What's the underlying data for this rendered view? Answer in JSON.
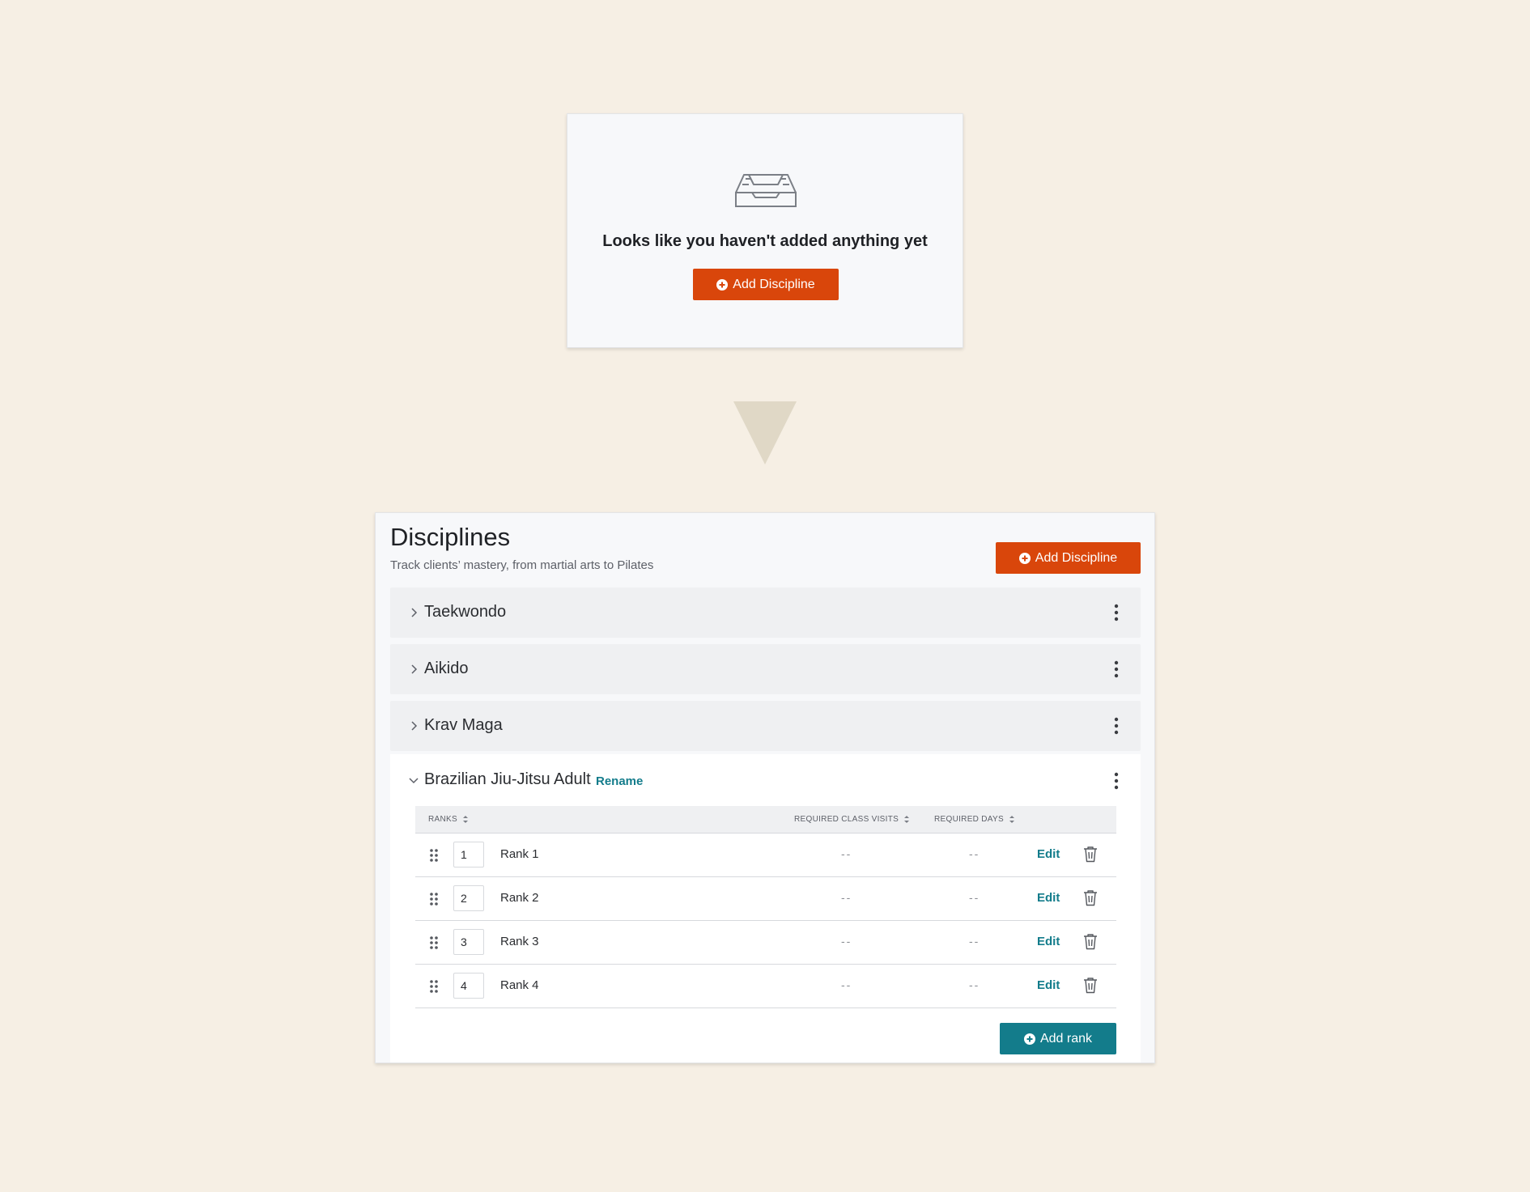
{
  "empty_state": {
    "icon": "inbox-tray-icon",
    "message": "Looks like you haven't added anything yet",
    "add_button_label": "Add Discipline"
  },
  "arrow": {
    "icon": "down-triangle-icon",
    "color": "#e0d8c6"
  },
  "disciplines_panel": {
    "title": "Disciplines",
    "subtitle": "Track clients’ mastery, from martial arts to Pilates",
    "add_button_label": "Add Discipline",
    "collapsed": [
      {
        "name": "Taekwondo"
      },
      {
        "name": "Aikido"
      },
      {
        "name": "Krav Maga"
      }
    ],
    "expanded": {
      "name": "Brazilian Jiu-Jitsu Adult",
      "rename_label": "Rename",
      "columns": {
        "ranks": "RANKS",
        "required_class_visits": "REQUIRED CLASS VISITS",
        "required_days": "REQUIRED DAYS"
      },
      "ranks": [
        {
          "order": "1",
          "name": "Rank 1",
          "visits": "--",
          "days": "--",
          "edit_label": "Edit"
        },
        {
          "order": "2",
          "name": "Rank 2",
          "visits": "--",
          "days": "--",
          "edit_label": "Edit"
        },
        {
          "order": "3",
          "name": "Rank 3",
          "visits": "--",
          "days": "--",
          "edit_label": "Edit"
        },
        {
          "order": "4",
          "name": "Rank 4",
          "visits": "--",
          "days": "--",
          "edit_label": "Edit"
        }
      ],
      "add_rank_label": "Add rank"
    }
  },
  "colors": {
    "background": "#f6efe4",
    "primary_orange": "#d9460b",
    "accent_teal": "#137c8b"
  }
}
